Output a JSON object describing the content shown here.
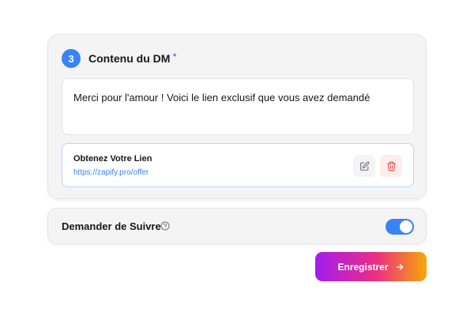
{
  "dm_section": {
    "step_number": "3",
    "title": "Contenu du DM",
    "required_marker": "*",
    "message": "Merci pour l'amour ! Voici le lien exclusif que vous avez demandé",
    "link": {
      "title": "Obtenez Votre Lien",
      "url": "https://zapify.pro/offer",
      "edit_icon": "pencil-square-icon",
      "delete_icon": "trash-icon"
    }
  },
  "follow_section": {
    "label": "Demander de Suivre",
    "help_icon": "question-circle-icon",
    "toggle_on": true
  },
  "actions": {
    "save_label": "Enregistrer",
    "save_icon": "arrow-right-icon"
  },
  "colors": {
    "accent": "#3b82f6",
    "danger": "#ef4444",
    "gradient_start": "#a21cf0",
    "gradient_mid": "#ec2e82",
    "gradient_end": "#f7a707"
  }
}
